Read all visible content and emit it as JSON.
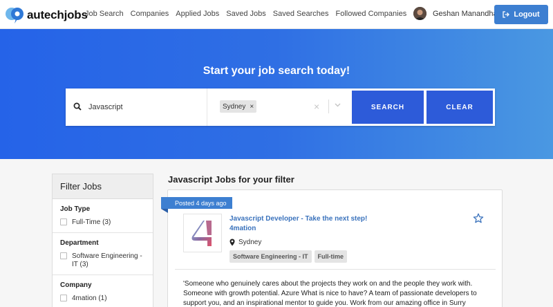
{
  "nav": {
    "logo_text": "autechjobs",
    "links": [
      "Job Search",
      "Companies",
      "Applied Jobs",
      "Saved Jobs",
      "Saved Searches",
      "Followed Companies"
    ],
    "user_name": "Geshan Manandhar",
    "logout_label": "Logout"
  },
  "hero": {
    "title": "Start your job search today!",
    "keyword_value": "Javascript",
    "location_chip": "Sydney",
    "chip_remove": "×",
    "clear_glyph": "×",
    "search_label": "SEARCH",
    "clear_label": "CLEAR"
  },
  "filter": {
    "title": "Filter Jobs",
    "sections": [
      {
        "title": "Job Type",
        "options": [
          "Full-Time (3)"
        ]
      },
      {
        "title": "Department",
        "options": [
          "Software Engineering - IT (3)"
        ]
      },
      {
        "title": "Company",
        "options": [
          "4mation (1)"
        ]
      }
    ]
  },
  "results": {
    "title": "Javascript Jobs for your filter",
    "job": {
      "posted": "Posted 4 days ago",
      "title": "Javascript Developer - Take the next step!",
      "company": "4mation",
      "location": "Sydney",
      "tags": [
        "Software Engineering - IT",
        "Full-time"
      ],
      "description": "'Someone who genuinely cares about the projects they work on and the people they work with. Someone with growth potential. Azure What is nice to have? A team of passionate developers to support you, and an inspirational mentor to guide you. Work from our amazing office in Surry"
    }
  },
  "colors": {
    "primary": "#3d7fd1",
    "button": "#2d5bd9",
    "hero_start": "#2563e8",
    "hero_end": "#4a98e2",
    "link": "#3a72bc"
  }
}
